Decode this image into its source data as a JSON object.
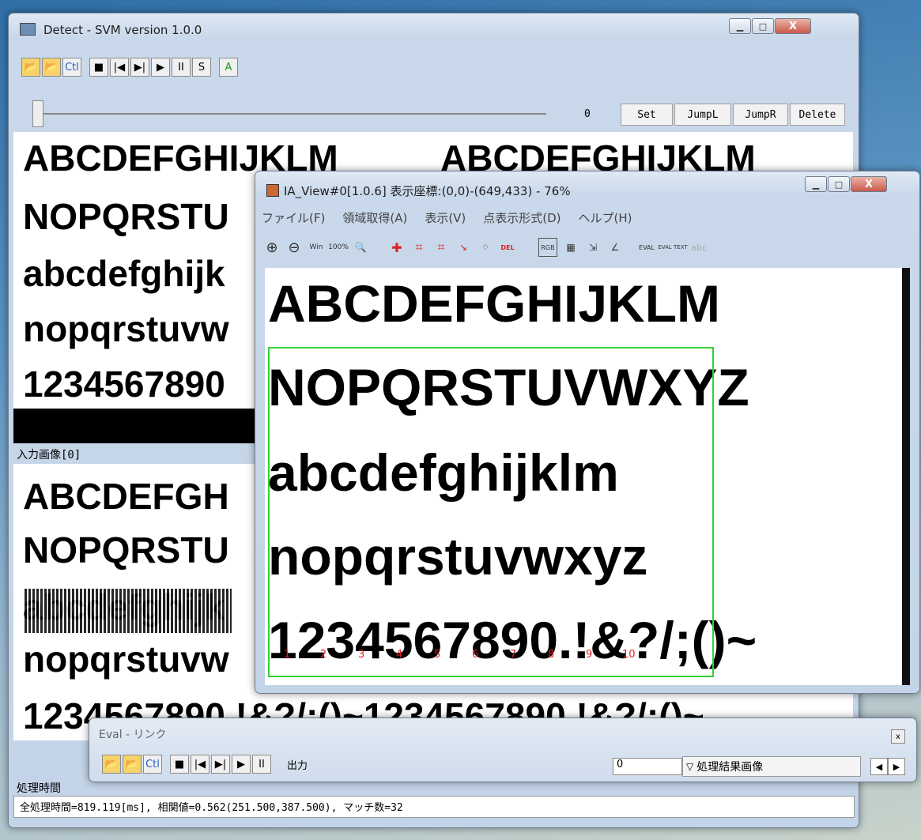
{
  "detect_window": {
    "title": "Detect - SVM version 1.0.0",
    "toolbar": [
      "Ctl",
      "■",
      "|◀",
      "▶|",
      "▶",
      "II",
      "S",
      "A"
    ],
    "slider_value": "0",
    "buttons": [
      "Set",
      "JumpL",
      "JumpR",
      "Delete"
    ],
    "text_lines": [
      "ABCDEFGHIJKLM",
      "NOPQRSTU",
      "abcdefghijk",
      "nopqrstuvw",
      "1234567890"
    ],
    "text_lines_right": [
      "ABCDEFGHIJKLM"
    ],
    "input_label": "入力画像[0]",
    "input_lines": [
      "ABCDEFGH",
      "NOPQRSTU",
      "abcdefghijk",
      "nopqrstuvw",
      "1234567890.!&?/;()~1234567890.!&?/;()~"
    ],
    "status_label": "処理時間",
    "status_text": "全処理時間=819.119[ms], 相関値=0.562(251.500,387.500), マッチ数=32"
  },
  "ia_view": {
    "title": "IA_View#0[1.0.6] 表示座標:(0,0)-(649,433) - 76%",
    "menu": [
      "ファイル(F)",
      "領域取得(A)",
      "表示(V)",
      "点表示形式(D)",
      "ヘルプ(H)"
    ],
    "toolbar": [
      "⊕",
      "⊖",
      "Win",
      "100%",
      "🔍",
      "✚",
      "⌗",
      "⌗",
      "↘",
      "⁘",
      "DEL",
      "RGB",
      "▦",
      "⇲",
      "∠",
      "EVAL",
      "EVAL TEXT",
      "abc"
    ],
    "lines": [
      "ABCDEFGHIJKLM",
      "NOPQRSTUVWXYZ",
      "abcdefghijklm",
      "nopqrstuvwxyz",
      "1234567890.!&?/;()~"
    ],
    "markers": [
      "1",
      "2",
      "3",
      "4",
      "5",
      "6",
      "7",
      "8",
      "9",
      "10"
    ],
    "accent_color": "#35d035"
  },
  "eval_window": {
    "title": "Eval - リンク",
    "toolbar": [
      "Ctl",
      "■",
      "|◀",
      "▶|",
      "▶",
      "II"
    ],
    "output_label": "出力",
    "value": "0",
    "select_value": "処理結果画像"
  }
}
